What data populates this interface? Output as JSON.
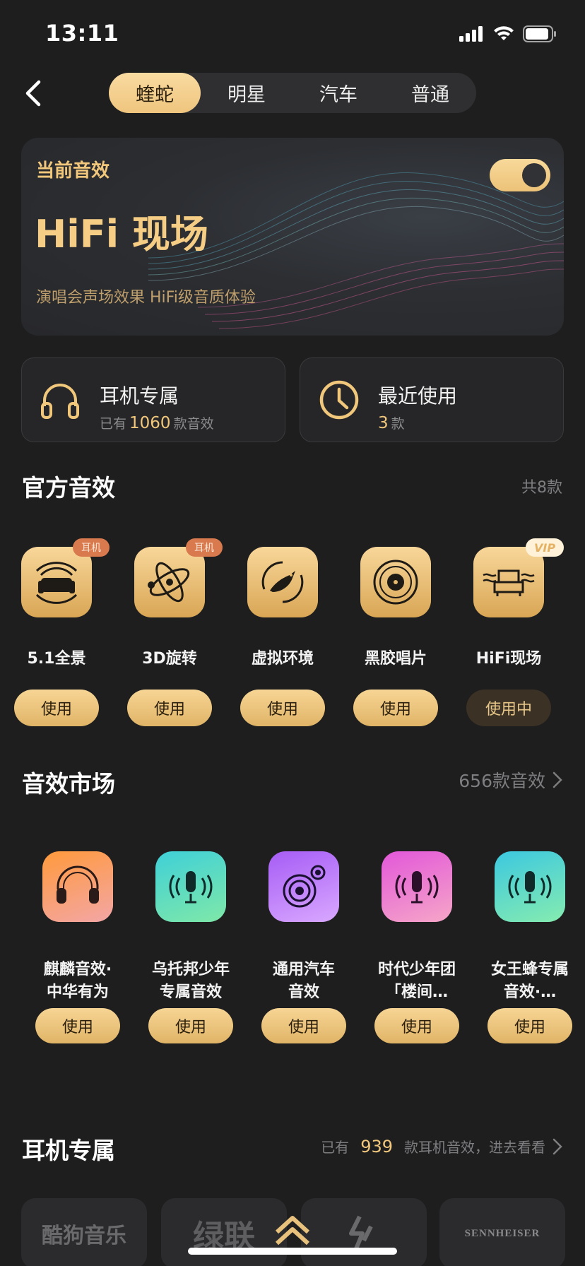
{
  "status_bar": {
    "time": "13:11"
  },
  "header": {
    "tabs": [
      {
        "label": "蝰蛇",
        "active": true
      },
      {
        "label": "明星",
        "active": false
      },
      {
        "label": "汽车",
        "active": false
      },
      {
        "label": "普通",
        "active": false
      }
    ]
  },
  "current_effect": {
    "label": "当前音效",
    "title": "HiFi 现场",
    "description": "演唱会声场效果 HiFi级音质体验",
    "enabled": true
  },
  "quick_cards": {
    "headphone": {
      "title": "耳机专属",
      "prefix": "已有",
      "count": "1060",
      "suffix": "款音效"
    },
    "recent": {
      "title": "最近使用",
      "count": "3",
      "suffix": "款"
    }
  },
  "official": {
    "title": "官方音效",
    "total": "共8款",
    "items": [
      {
        "name": "5.1全景",
        "badge": "耳机",
        "button": "使用",
        "icon": "sofa-icon"
      },
      {
        "name": "3D旋转",
        "badge": "耳机",
        "button": "使用",
        "icon": "orbit-icon"
      },
      {
        "name": "虚拟环境",
        "badge": "",
        "button": "使用",
        "icon": "bird-icon"
      },
      {
        "name": "黑胶唱片",
        "badge": "",
        "button": "使用",
        "icon": "vinyl-icon"
      },
      {
        "name": "HiFi现场",
        "badge": "VIP",
        "button": "使用中",
        "icon": "armchair-icon"
      }
    ]
  },
  "market": {
    "title": "音效市场",
    "total": "656款音效",
    "items": [
      {
        "line1": "麒麟音效·",
        "line2": "中华有为",
        "button": "使用",
        "icon": "headphones-icon",
        "colors": [
          "#ff9a3c",
          "#f3a6a6"
        ]
      },
      {
        "line1": "乌托邦少年",
        "line2": "专属音效",
        "button": "使用",
        "icon": "microphone-icon",
        "colors": [
          "#3fd0d8",
          "#7fe8a8"
        ]
      },
      {
        "line1": "通用汽车",
        "line2": "音效",
        "button": "使用",
        "icon": "speaker-icon",
        "colors": [
          "#a65cf5",
          "#d9a8ff"
        ]
      },
      {
        "line1": "时代少年团",
        "line2": "「楼间…",
        "button": "使用",
        "icon": "microphone-icon",
        "colors": [
          "#e257d9",
          "#f6a6c8"
        ]
      },
      {
        "line1": "女王蜂专属",
        "line2": "音效·…",
        "button": "使用",
        "icon": "microphone-icon",
        "colors": [
          "#3cc8e0",
          "#86ecb0"
        ]
      }
    ]
  },
  "headphone_section": {
    "title": "耳机专属",
    "prefix": "已有",
    "count": "939",
    "suffix": "款耳机音效，进去看看",
    "brands": [
      "酷狗音乐",
      "绿联",
      "",
      "SENNHEISER"
    ]
  },
  "colors": {
    "accent": "#f1c77c",
    "background": "#1e1e1f",
    "card": "#262628"
  }
}
